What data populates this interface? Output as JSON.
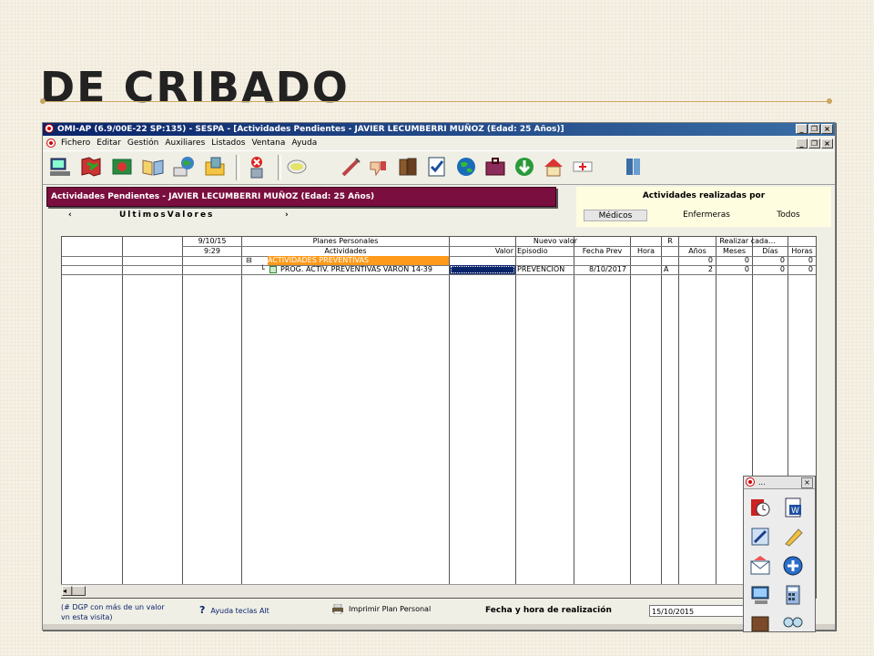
{
  "slide": {
    "title": "DE CRIBADO"
  },
  "window": {
    "title": "OMI-AP (6.9/00E-22 SP:135) - SESPA - [Actividades Pendientes - JAVIER LECUMBERRI MUÑOZ (Edad: 25 Años)]",
    "controls": [
      "_",
      "❐",
      "×"
    ]
  },
  "menu": {
    "items": [
      "Fichero",
      "Editar",
      "Gestión",
      "Auxiliares",
      "Listados",
      "Ventana",
      "Ayuda"
    ]
  },
  "band": {
    "title": "Actividades Pendientes - JAVIER LECUMBERRI MUÑOZ (Edad: 25 Años)"
  },
  "nav": {
    "prev": "‹",
    "label": "UltimosValores",
    "next": "›"
  },
  "activities_panel": {
    "title": "Actividades realizadas por",
    "tabs": [
      "Médicos",
      "Enfermeras",
      "Todos"
    ]
  },
  "grid": {
    "date": "9/10/15",
    "time": "9:29",
    "group_planes": "Planes Personales",
    "group_nuevo": "Nuevo valor",
    "group_r": "R",
    "group_realizar": "Realizar cada...",
    "columns": {
      "actividades": "Actividades",
      "valor": "Valor",
      "episodio": "Episodio",
      "fecha_prev": "Fecha Prev",
      "hora": "Hora",
      "anos": "Años",
      "meses": "Meses",
      "dias": "Días",
      "horas": "Horas"
    },
    "rows": [
      {
        "tree": "⊟",
        "actividad": "ACTIVIDADES PREVENTIVAS",
        "valor": "",
        "episodio": "",
        "fecha_prev": "",
        "hora": "",
        "r": "",
        "anos": "0",
        "meses": "0",
        "dias": "0",
        "horas": "0"
      },
      {
        "tree": "└",
        "actividad": "PROG. ACTIV. PREVENTIVAS VARON 14-39",
        "valor": "",
        "episodio": "PREVENCION",
        "fecha_prev": "8/10/2017",
        "hora": "",
        "r": "A",
        "anos": "2",
        "meses": "0",
        "dias": "0",
        "horas": "0"
      }
    ]
  },
  "footer": {
    "note_line1": "(# DGP con más de un valor",
    "note_line2": "vn esta visita)",
    "help_icon": "?",
    "help": "Ayuda teclas Alt",
    "print": "Imprimir Plan Personal",
    "date_label": "Fecha y hora de realización",
    "date_value": "15/10/2015"
  },
  "palette": {
    "title_dots": "...",
    "close": "×"
  },
  "colors": {
    "band": "#7a0e3e",
    "highlight_row": "#ff9a1a",
    "selected_cell": "#0a246a",
    "titlebar": "#0a246a"
  },
  "icons": {
    "toolbar": [
      "computer-icon",
      "map-icon",
      "photo-icon",
      "open-book-icon",
      "globe-icon",
      "folder-icon",
      "cancel-icon",
      "tape-icon",
      "syringe-icon",
      "thumb-down-icon",
      "folders-icon",
      "check-icon",
      "earth-icon",
      "briefcase-icon",
      "download-icon",
      "house-icon",
      "bandage-icon",
      "door-icon"
    ],
    "palette": [
      "clock-icon",
      "word-icon",
      "pen-icon",
      "pencil-icon",
      "mail-icon",
      "plus-icon",
      "monitor-icon",
      "calculator-icon",
      "box-icon",
      "glasses-icon"
    ]
  }
}
